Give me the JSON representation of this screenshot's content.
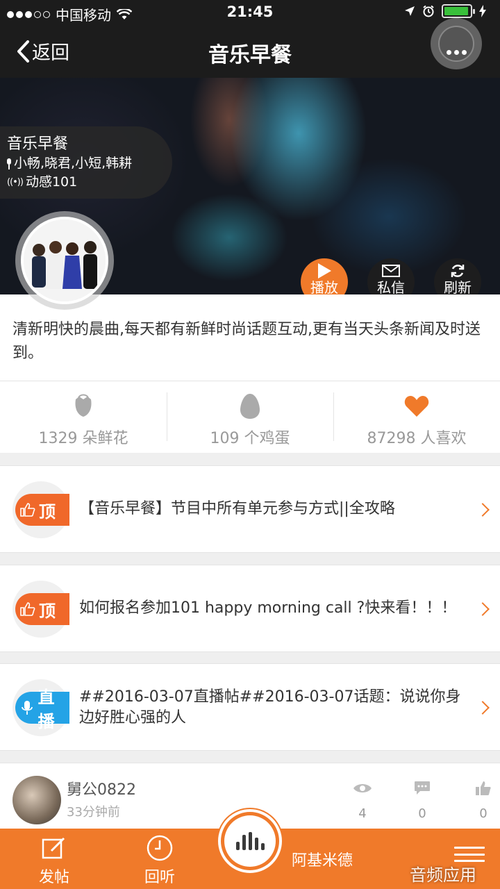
{
  "status_bar": {
    "carrier": "中国移动",
    "time": "21:45",
    "battery_level": 0.95
  },
  "nav": {
    "back_label": "返回",
    "title": "音乐早餐"
  },
  "hero": {
    "show_name": "音乐早餐",
    "hosts": "小畅,晓君,小短,韩耕",
    "station": "动感101",
    "actions": {
      "play": "播放",
      "message": "私信",
      "refresh": "刷新"
    }
  },
  "description": "清新明快的晨曲,每天都有新鲜时尚话题互动,更有当天头条新闻及时送到。",
  "stats": {
    "flowers": "1329 朵鲜花",
    "eggs": "109 个鸡蛋",
    "likes": "87298 人喜欢"
  },
  "topics": [
    {
      "badge": "顶",
      "text": "【音乐早餐】节目中所有单元参与方式||全攻略"
    },
    {
      "badge": "顶",
      "text": "如何报名参加101 happy morning call ?快来看！！！"
    },
    {
      "badge": "直播",
      "text": "##2016-03-07直播帖##2016-03-07话题：说说你身边好胜心强的人"
    }
  ],
  "post": {
    "user": "舅公0822",
    "time": "33分钟前",
    "views": "4",
    "comments": "0",
    "likes": "0"
  },
  "tabbar": {
    "post_label": "发帖",
    "replay_label": "回听",
    "now_playing": "阿基米德"
  },
  "watermark": "音频应用",
  "colors": {
    "accent": "#f07a2a",
    "live_blue": "#24a3e6",
    "dark_bar": "#1c1c1c"
  }
}
